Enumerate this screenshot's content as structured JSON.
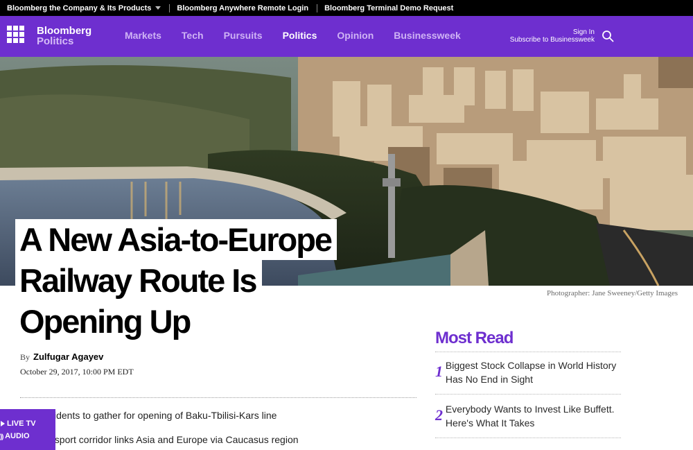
{
  "topbar": {
    "company_link": "Bloomberg the Company & Its Products",
    "remote_login": "Bloomberg Anywhere Remote Login",
    "demo_request": "Bloomberg Terminal Demo Request"
  },
  "nav": {
    "brand_line1": "Bloomberg",
    "brand_line2": "Politics",
    "links": [
      "Markets",
      "Tech",
      "Pursuits",
      "Politics",
      "Opinion",
      "Businessweek"
    ],
    "active": "Politics",
    "sign_in": "Sign In",
    "subscribe": "Subscribe to Businessweek",
    "colors": {
      "nav_bg": "#6e2fcf",
      "inactive_link": "#cfb3f5"
    }
  },
  "hero": {
    "credit": "Photographer: Jane Sweeney/Getty Images"
  },
  "article": {
    "headline_lines": [
      "A New Asia-to-Europe",
      "Railway Route Is",
      "Opening Up"
    ],
    "by_label": "By",
    "author": "Zulfugar Agayev",
    "date": "October 29, 2017, 10:00 PM EDT",
    "bullets": [
      "sidents to gather for opening of Baku-Tbilisi-Kars line",
      "nsport corridor links Asia and Europe via Caucasus region"
    ]
  },
  "live": {
    "live_tv": "LIVE TV",
    "audio": "AUDIO"
  },
  "most_read": {
    "title": "Most Read",
    "items": [
      {
        "num": "1",
        "text": "Biggest Stock Collapse in World History Has No End in Sight"
      },
      {
        "num": "2",
        "text": "Everybody Wants to Invest Like Buffett. Here's What It Takes"
      }
    ]
  }
}
